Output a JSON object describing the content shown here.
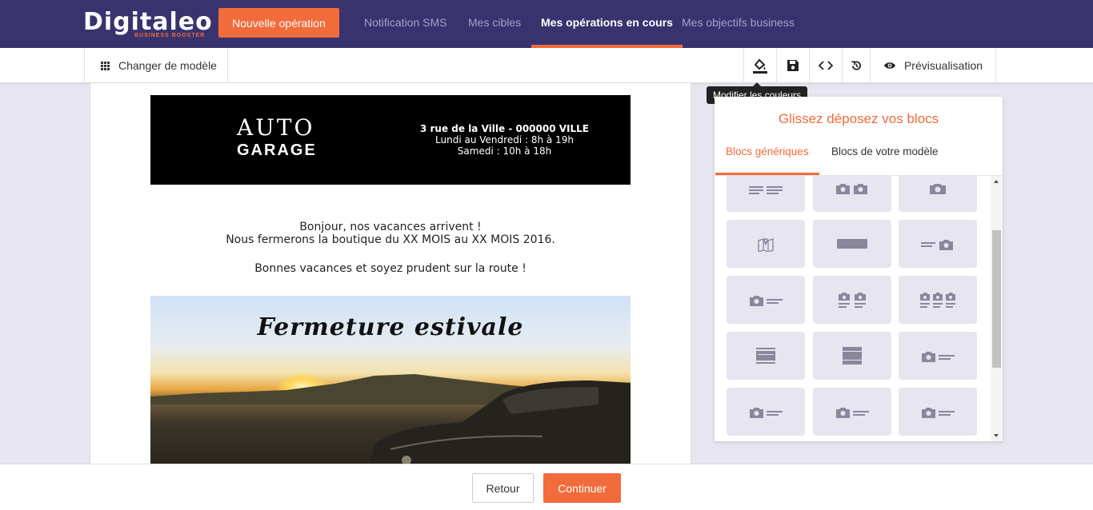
{
  "nav": {
    "logo": "Digitaleo",
    "logo_tagline": "BUSINESS BOOSTER",
    "new_operation": "Nouvelle opération",
    "links": [
      "Notification SMS",
      "Mes cibles",
      "Mes opérations en cours",
      "Mes objectifs business"
    ],
    "active_link": "Mes opérations en cours"
  },
  "toolbar": {
    "change_template": "Changer de modèle",
    "preview": "Prévisualisation",
    "tooltip": "Modifier les couleurs",
    "icons": [
      "paint-bucket-icon",
      "save-icon",
      "code-icon",
      "history-icon",
      "eye-icon"
    ]
  },
  "email": {
    "brand_line1": "AUTO",
    "brand_line2": "GARAGE",
    "address": "3 rue de la Ville - 000000 VILLE",
    "hours_week": "Lundi au Vendredi : 8h à 19h",
    "hours_sat": "Samedi : 10h à 18h",
    "text_line1": "Bonjour, nos vacances arrivent !",
    "text_line2": "Nous fermerons la boutique du XX MOIS au XX MOIS 2016.",
    "text_line3": "Bonnes vacances et soyez prudent sur la route !",
    "photo_title": "Fermeture estivale"
  },
  "panel": {
    "title": "Glissez déposez vos blocs",
    "tab_generic": "Blocs génériques",
    "tab_model": "Blocs de votre modèle",
    "active_tab": "Blocs génériques",
    "blocks": [
      [
        "text-text-icon",
        "two-photos-icon",
        "photo-icon"
      ],
      [
        "map-icon",
        "divider-icon",
        "text-photo-icon"
      ],
      [
        "photo-text-icon",
        "two-photo-caption-icon",
        "three-photo-caption-icon"
      ],
      [
        "banner-icon",
        "full-banner-icon",
        "photo-text-icon"
      ],
      [
        "photo-text-icon",
        "photo-text-icon",
        "photo-text-icon"
      ]
    ]
  },
  "footer": {
    "back": "Retour",
    "continue": "Continuer"
  },
  "colors": {
    "nav_bg": "#38336f",
    "accent": "#f26b3a",
    "page_bg": "#e6e5f0",
    "block_bg": "#e6e5f0",
    "block_icon": "#8a879c"
  }
}
